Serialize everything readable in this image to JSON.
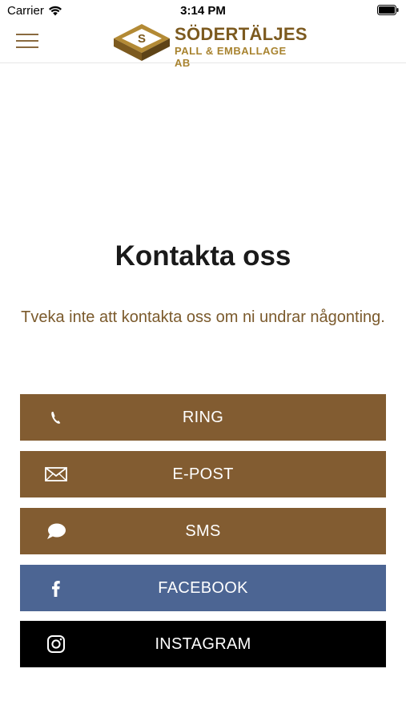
{
  "status_bar": {
    "carrier": "Carrier",
    "time": "3:14 PM"
  },
  "header": {
    "logo_line1": "SÖDERTÄLJES",
    "logo_line2": "PALL & EMBALLAGE AB"
  },
  "main": {
    "title": "Kontakta oss",
    "subtitle": "Tveka inte att kontakta oss om ni undrar någonting."
  },
  "buttons": [
    {
      "label": "RING",
      "icon": "phone-icon"
    },
    {
      "label": "E-POST",
      "icon": "envelope-icon"
    },
    {
      "label": "SMS",
      "icon": "chat-bubble-icon"
    },
    {
      "label": "FACEBOOK",
      "icon": "facebook-icon"
    },
    {
      "label": "INSTAGRAM",
      "icon": "instagram-icon"
    }
  ],
  "colors": {
    "brand_brown": "#825c31",
    "facebook_blue": "#4c6593",
    "instagram_black": "#000000",
    "subtitle_brown": "#7b5a2c"
  }
}
